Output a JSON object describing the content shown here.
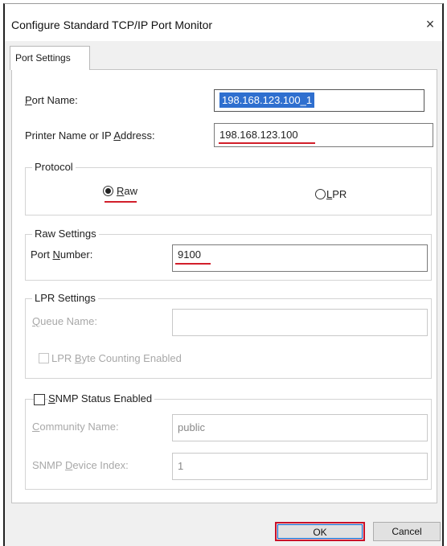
{
  "window": {
    "title": "Configure Standard TCP/IP Port Monitor",
    "close_glyph": "×"
  },
  "tabs": [
    {
      "label": "Port Settings"
    }
  ],
  "port_name": {
    "label": "Port Name:",
    "value": "198.168.123.100_1"
  },
  "printer_address": {
    "label": "Printer Name or IP Address:",
    "value": "198.168.123.100"
  },
  "protocol": {
    "title": "Protocol",
    "options": [
      {
        "label": "Raw",
        "selected": true
      },
      {
        "label": "LPR",
        "selected": false
      }
    ]
  },
  "raw_settings": {
    "title": "Raw Settings",
    "port_number_label": "Port Number:",
    "port_number_value": "9100"
  },
  "lpr_settings": {
    "title": "LPR Settings",
    "queue_name_label": "Queue Name:",
    "queue_name_value": "",
    "byte_counting_label": "LPR Byte Counting Enabled",
    "byte_counting_checked": false
  },
  "snmp": {
    "label": "SNMP Status Enabled",
    "checked": false,
    "community_name_label": "Community Name:",
    "community_name_value": "public",
    "device_index_label": "SNMP Device Index:",
    "device_index_value": "1"
  },
  "buttons": {
    "ok": "OK",
    "cancel": "Cancel"
  },
  "colors": {
    "highlight": "#d21f2b",
    "selection": "#2f6fcf",
    "focus": "#0a66d6"
  }
}
